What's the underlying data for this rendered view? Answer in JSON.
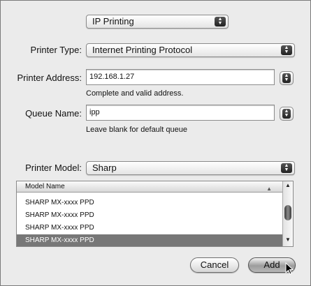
{
  "dialog": {
    "protocol_popup": "IP Printing",
    "printer_type": {
      "label": "Printer Type:",
      "value": "Internet Printing Protocol"
    },
    "printer_address": {
      "label": "Printer Address:",
      "value": "192.168.1.27",
      "hint": "Complete and valid address."
    },
    "queue_name": {
      "label": "Queue Name:",
      "value": "ipp",
      "hint": "Leave blank for default queue"
    },
    "printer_model": {
      "label": "Printer Model:",
      "value": "Sharp"
    },
    "model_list": {
      "header": "Model Name",
      "rows": [
        "SHARP MX-xxxx PPD",
        "SHARP MX-xxxx PPD",
        "SHARP MX-xxxx PPD",
        "SHARP MX-xxxx PPD"
      ],
      "selected_index": 3
    },
    "buttons": {
      "cancel": "Cancel",
      "add": "Add"
    }
  },
  "icons": {
    "popup_arrows": "up-down-arrows-icon",
    "sort": "sort-ascending-icon",
    "cursor": "mouse-pointer-icon"
  }
}
